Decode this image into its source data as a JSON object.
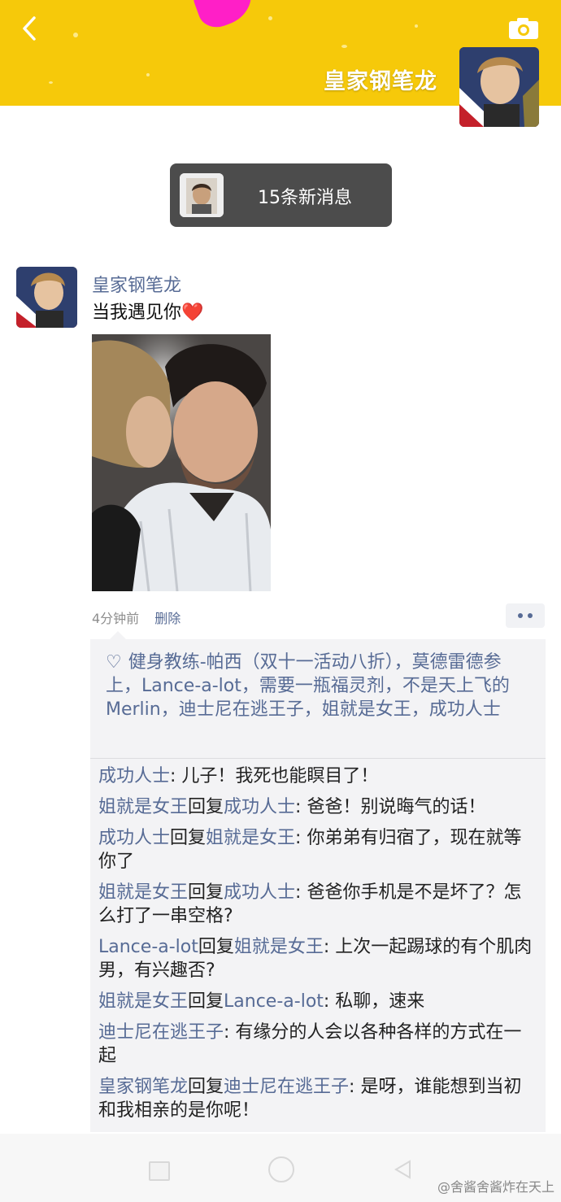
{
  "header": {
    "cover_name": "皇家钢笔龙",
    "back_icon": "chevron-left-icon",
    "camera_icon": "camera-icon"
  },
  "new_messages": {
    "label": "15条新消息"
  },
  "post": {
    "author": "皇家钢笔龙",
    "text": "当我遇见你",
    "emoji": "❤️",
    "time": "4分钟前",
    "delete_label": "删除"
  },
  "likes": {
    "heart": "♡",
    "names": "健身教练-帕西（双十一活动八折），莫德雷德参上，Lance-a-lot，需要一瓶福灵剂，不是天上飞的Merlin，迪士尼在逃王子，姐就是女王，成功人士"
  },
  "comments": [
    {
      "from": "成功人士",
      "reply_word": "",
      "to": "",
      "text": ": 儿子！我死也能瞑目了！"
    },
    {
      "from": "姐就是女王",
      "reply_word": "回复",
      "to": "成功人士",
      "text": ": 爸爸！别说晦气的话！"
    },
    {
      "from": "成功人士",
      "reply_word": "回复",
      "to": "姐就是女王",
      "text": ": 你弟弟有归宿了，现在就等你了"
    },
    {
      "from": "姐就是女王",
      "reply_word": "回复",
      "to": "成功人士",
      "text": ": 爸爸你手机是不是坏了？怎么打了一串空格?"
    },
    {
      "from": "Lance-a-lot",
      "reply_word": "回复",
      "to": "姐就是女王",
      "text": ": 上次一起踢球的有个肌肉男，有兴趣否?"
    },
    {
      "from": "姐就是女王",
      "reply_word": "回复",
      "to": "Lance-a-lot",
      "text": ": 私聊，速来"
    },
    {
      "from": "迪士尼在逃王子",
      "reply_word": "",
      "to": "",
      "text": ": 有缘分的人会以各种各样的方式在一起"
    },
    {
      "from": "皇家钢笔龙",
      "reply_word": "回复",
      "to": "迪士尼在逃王子",
      "text": ": 是呀，谁能想到当初和我相亲的是你呢！"
    }
  ],
  "footer": {
    "watermark": "@舍酱舍酱炸在天上"
  },
  "colors": {
    "cover": "#f6c90a",
    "link": "#576b95",
    "pill": "#4c4c4c"
  }
}
